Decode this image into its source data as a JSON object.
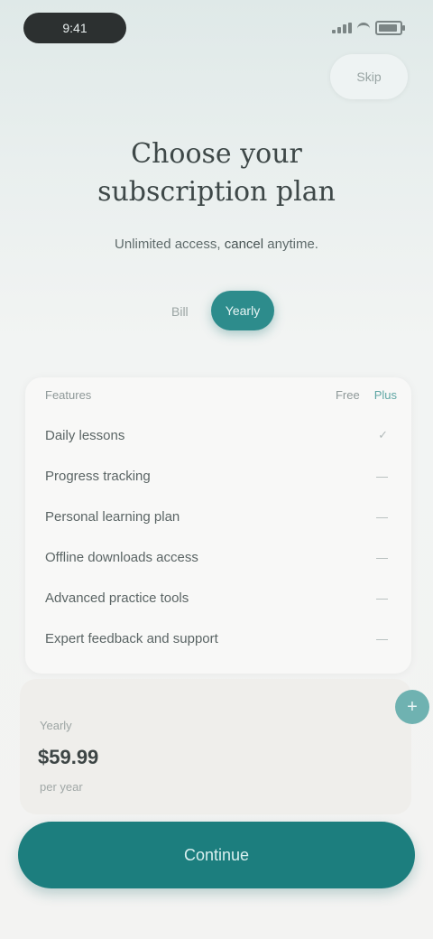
{
  "status_bar": {
    "time": "9:41"
  },
  "top_action": {
    "label": "Skip"
  },
  "headline": {
    "line1": "Choose your",
    "line2": "subscription plan"
  },
  "subline": {
    "part1": "Unlimited access,",
    "part2": "cancel",
    "part3": "anytime."
  },
  "billing_toggle": {
    "label": "Bill",
    "active": "Yearly"
  },
  "features_card": {
    "header_left": "Features",
    "header_right_1": "Free",
    "header_right_2": "Plus",
    "rows": [
      {
        "label": "Daily lessons",
        "value": "✓"
      },
      {
        "label": "Progress tracking",
        "value": "—"
      },
      {
        "label": "Personal learning plan",
        "value": "—"
      },
      {
        "label": "Offline downloads access",
        "value": "—"
      },
      {
        "label": "Advanced practice tools",
        "value": "—"
      },
      {
        "label": "Expert feedback and support",
        "value": "—"
      }
    ]
  },
  "lower_panel": {
    "small": "Yearly",
    "price": "$59.99",
    "sub": "per year"
  },
  "fab": {
    "label": "+"
  },
  "cta": {
    "label": "Continue"
  },
  "colors": {
    "accent": "#2d8c8c",
    "cta": "#1c7e7e"
  }
}
